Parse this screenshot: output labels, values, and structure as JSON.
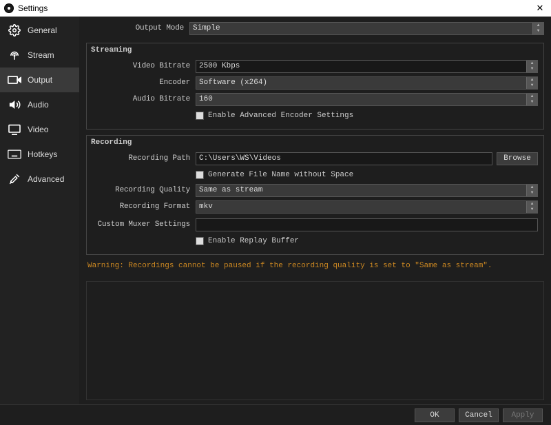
{
  "window": {
    "title": "Settings"
  },
  "sidebar": {
    "items": [
      {
        "label": "General"
      },
      {
        "label": "Stream"
      },
      {
        "label": "Output"
      },
      {
        "label": "Audio"
      },
      {
        "label": "Video"
      },
      {
        "label": "Hotkeys"
      },
      {
        "label": "Advanced"
      }
    ]
  },
  "content": {
    "output_mode": {
      "label": "Output Mode",
      "value": "Simple"
    },
    "streaming": {
      "legend": "Streaming",
      "video_bitrate": {
        "label": "Video Bitrate",
        "value": "2500 Kbps"
      },
      "encoder": {
        "label": "Encoder",
        "value": "Software (x264)"
      },
      "audio_bitrate": {
        "label": "Audio Bitrate",
        "value": "160"
      },
      "advanced_checkbox": "Enable Advanced Encoder Settings"
    },
    "recording": {
      "legend": "Recording",
      "path": {
        "label": "Recording Path",
        "value": "C:\\Users\\WS\\Videos",
        "browse": "Browse"
      },
      "nospace_checkbox": "Generate File Name without Space",
      "quality": {
        "label": "Recording Quality",
        "value": "Same as stream"
      },
      "format": {
        "label": "Recording Format",
        "value": "mkv"
      },
      "muxer": {
        "label": "Custom Muxer Settings",
        "value": ""
      },
      "replay_checkbox": "Enable Replay Buffer"
    },
    "warning": "Warning: Recordings cannot be paused if the recording quality is set to \"Same as stream\"."
  },
  "footer": {
    "ok": "OK",
    "cancel": "Cancel",
    "apply": "Apply"
  }
}
